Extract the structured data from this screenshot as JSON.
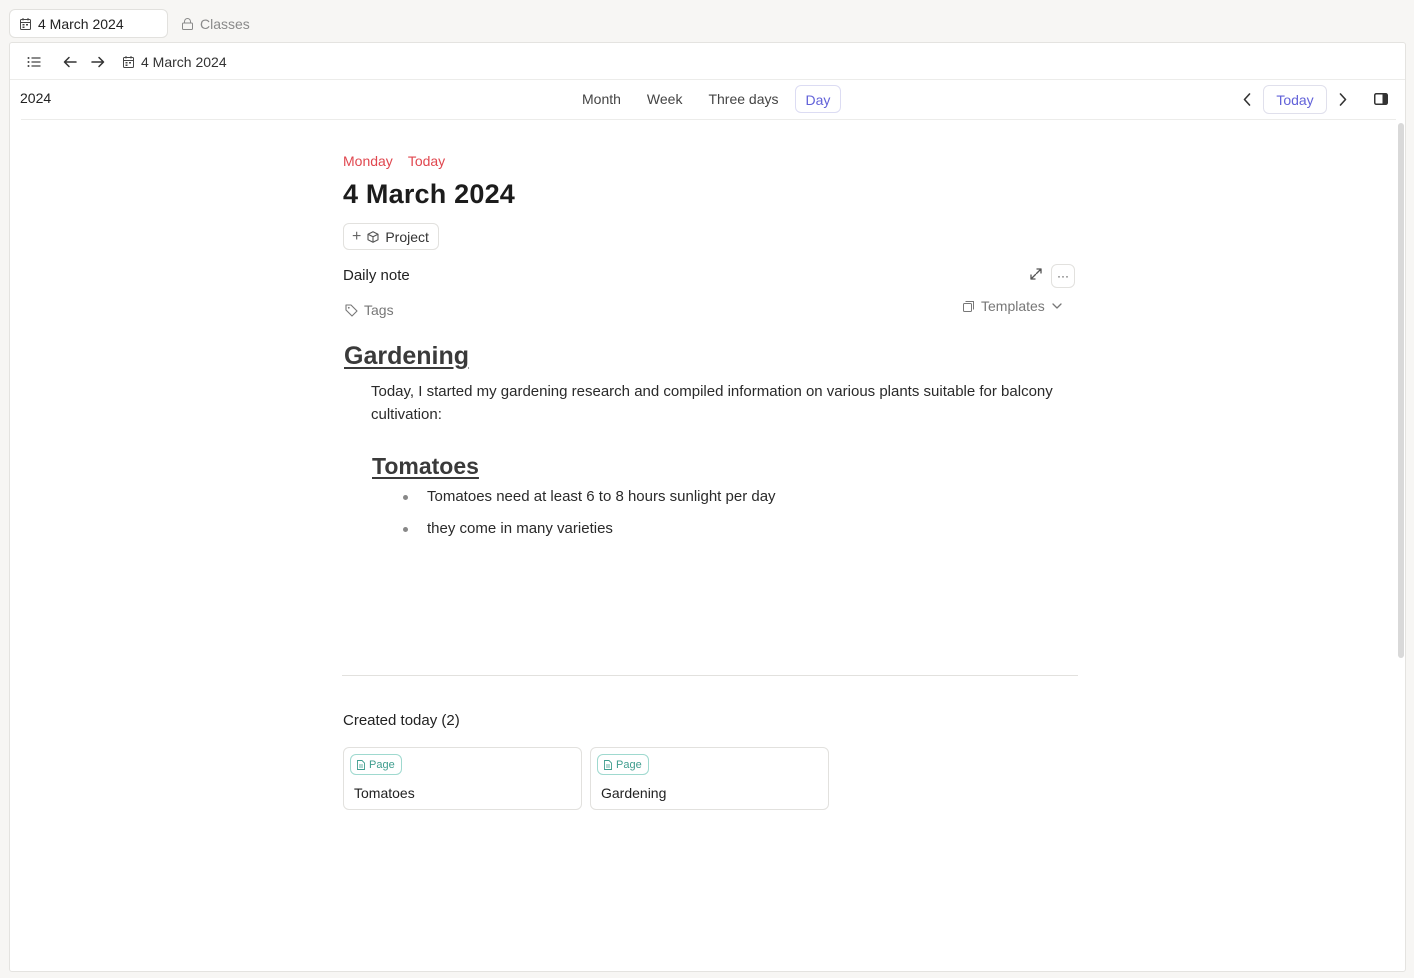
{
  "tabs": [
    {
      "label": "4 March 2024",
      "icon": "calendar-icon",
      "active": true
    },
    {
      "label": "Classes",
      "icon": "lock-icon",
      "active": false
    }
  ],
  "toolbar": {
    "breadcrumb": "4 March 2024"
  },
  "calendar": {
    "year": "2024",
    "views": [
      "Month",
      "Week",
      "Three days",
      "Day"
    ],
    "active_view": "Day",
    "today_label": "Today"
  },
  "day": {
    "weekday": "Monday",
    "relative": "Today",
    "title": "4 March 2024",
    "project_label": "Project"
  },
  "note": {
    "label": "Daily note",
    "tags_label": "Tags",
    "templates_label": "Templates",
    "heading1": "Gardening",
    "paragraph": "Today, I started my gardening research and compiled information on various plants suitable for balcony cultivation:",
    "heading2": "Tomatoes",
    "bullets": [
      "Tomatoes need at least 6 to 8 hours sunlight per day",
      "they come in many varieties"
    ]
  },
  "created": {
    "title": "Created today (2)",
    "cards": [
      {
        "badge": "Page",
        "title": "Tomatoes"
      },
      {
        "badge": "Page",
        "title": "Gardening"
      }
    ]
  },
  "colors": {
    "accent": "#6262d9",
    "today_red": "#e0474f",
    "badge_teal": "#3f9d8e"
  }
}
